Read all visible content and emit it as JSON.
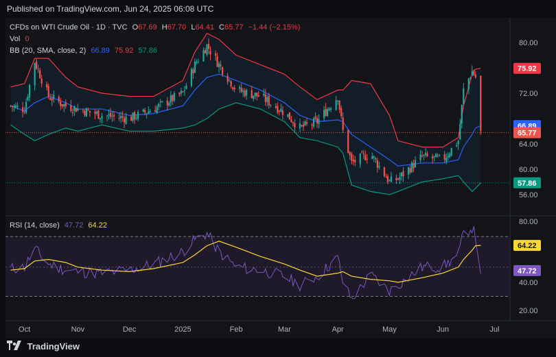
{
  "header": {
    "published": "Published on TradingView.com, Jun 24, 2025 06:08 UTC"
  },
  "footer": {
    "brand": "TradingView"
  },
  "legend": {
    "symbol": "CFDs on WTI Crude Oil · 1D · TVC",
    "o_label": "O",
    "o_value": "67.69",
    "h_label": "H",
    "h_value": "67.70",
    "l_label": "L",
    "l_value": "64.41",
    "c_label": "C",
    "c_value": "65.77",
    "change": "−1.44 (−2.15%)",
    "vol_label": "Vol",
    "vol_value": "0",
    "bb_label": "BB (20, SMA, close, 2)",
    "bb_basis": "66.89",
    "bb_upper": "75.92",
    "bb_lower": "57.86",
    "rsi_label": "RSI (14, close)",
    "rsi_value": "47.72",
    "rsi_ma": "64.22"
  },
  "colors": {
    "up": "#26a69a",
    "down": "#ef5350",
    "basis": "#2962ff",
    "upper": "#f23645",
    "lower": "#089981",
    "rsi": "#7e57c2",
    "rsi_ma": "#fdd835"
  },
  "chart_data": [
    {
      "type": "candlestick",
      "title": "CFDs on WTI Crude Oil · 1D · TVC",
      "ylim": [
        52.5,
        82
      ],
      "y_ticks": [
        "80.00",
        "72.00",
        "64.00",
        "60.00",
        "56.00"
      ],
      "x_ticks": [
        "Oct",
        "Nov",
        "Dec",
        "2025",
        "Feb",
        "Mar",
        "Apr",
        "May",
        "Jun",
        "Jul"
      ],
      "price_labels": {
        "upper": "75.92",
        "basis": "66.89",
        "last": "65.77",
        "lower": "57.86"
      },
      "close_series": {
        "x": [
          "2024-09-23",
          "2024-10-01",
          "2024-10-07",
          "2024-10-15",
          "2024-10-25",
          "2024-11-01",
          "2024-11-15",
          "2024-12-01",
          "2024-12-15",
          "2025-01-01",
          "2025-01-08",
          "2025-01-15",
          "2025-01-22",
          "2025-02-01",
          "2025-02-15",
          "2025-03-01",
          "2025-03-10",
          "2025-03-20",
          "2025-04-01",
          "2025-04-04",
          "2025-04-09",
          "2025-04-20",
          "2025-05-01",
          "2025-05-06",
          "2025-05-20",
          "2025-06-01",
          "2025-06-10",
          "2025-06-13",
          "2025-06-18",
          "2025-06-20",
          "2025-06-23"
        ],
        "values": [
          70.0,
          69.5,
          77.0,
          71.5,
          70.0,
          69.5,
          68.5,
          68.0,
          69.5,
          72.0,
          76.5,
          79.5,
          76.5,
          72.5,
          71.5,
          69.0,
          66.5,
          67.5,
          71.5,
          66.0,
          61.0,
          62.5,
          58.0,
          58.5,
          62.0,
          61.5,
          64.5,
          72.5,
          75.5,
          74.5,
          65.77
        ]
      },
      "bollinger": {
        "basis": [
          70.0,
          69.2,
          70.5,
          71.5,
          70.5,
          69.5,
          69.5,
          68.5,
          68.8,
          70.0,
          72.5,
          74.5,
          75.0,
          74.0,
          72.5,
          70.5,
          68.5,
          67.5,
          67.8,
          67.5,
          65.5,
          63.5,
          61.5,
          60.5,
          61.0,
          61.0,
          61.5,
          63.5,
          65.5,
          66.5,
          66.89
        ],
        "upper": [
          73.0,
          73.5,
          77.5,
          77.5,
          74.5,
          73.0,
          72.0,
          71.5,
          71.5,
          74.0,
          78.5,
          81.5,
          80.5,
          78.0,
          76.5,
          75.0,
          73.0,
          71.0,
          72.5,
          72.5,
          74.0,
          73.5,
          68.5,
          64.5,
          63.5,
          63.5,
          65.0,
          70.0,
          75.0,
          75.8,
          75.92
        ],
        "lower": [
          67.0,
          65.5,
          64.5,
          65.5,
          66.5,
          66.0,
          67.0,
          66.0,
          66.0,
          66.5,
          67.0,
          68.0,
          69.5,
          70.5,
          69.5,
          67.5,
          65.0,
          64.5,
          63.5,
          62.5,
          57.5,
          56.5,
          56.0,
          56.5,
          58.0,
          58.5,
          59.0,
          58.0,
          56.5,
          57.0,
          57.86
        ]
      }
    },
    {
      "type": "line",
      "title": "RSI (14, close)",
      "ylim": [
        20,
        80
      ],
      "y_ticks": [
        "80.00",
        "40.00",
        "20.00"
      ],
      "bands": [
        70,
        50,
        30
      ],
      "price_labels": {
        "rsi_ma": "64.22",
        "rsi": "47.72"
      },
      "x": [
        "2024-09-23",
        "2024-10-01",
        "2024-10-07",
        "2024-10-15",
        "2024-10-25",
        "2024-11-01",
        "2024-11-15",
        "2024-12-01",
        "2024-12-15",
        "2025-01-01",
        "2025-01-08",
        "2025-01-15",
        "2025-01-22",
        "2025-02-01",
        "2025-02-15",
        "2025-03-01",
        "2025-03-10",
        "2025-03-20",
        "2025-04-01",
        "2025-04-04",
        "2025-04-09",
        "2025-04-20",
        "2025-05-01",
        "2025-05-06",
        "2025-05-20",
        "2025-06-01",
        "2025-06-10",
        "2025-06-13",
        "2025-06-18",
        "2025-06-20",
        "2025-06-23"
      ],
      "series": [
        {
          "values": [
            49,
            50,
            62,
            52,
            48,
            47,
            46,
            48,
            52,
            60,
            68,
            72,
            60,
            50,
            48,
            44,
            38,
            44,
            56,
            40,
            28,
            45,
            34,
            38,
            50,
            50,
            58,
            72,
            76,
            70,
            47.72
          ]
        },
        {
          "values": [
            48,
            49,
            54,
            55,
            53,
            50,
            48,
            47,
            49,
            53,
            58,
            64,
            67,
            63,
            57,
            52,
            48,
            44,
            46,
            47,
            44,
            42,
            41,
            40,
            43,
            46,
            50,
            55,
            61,
            64,
            64.22
          ]
        }
      ]
    }
  ]
}
